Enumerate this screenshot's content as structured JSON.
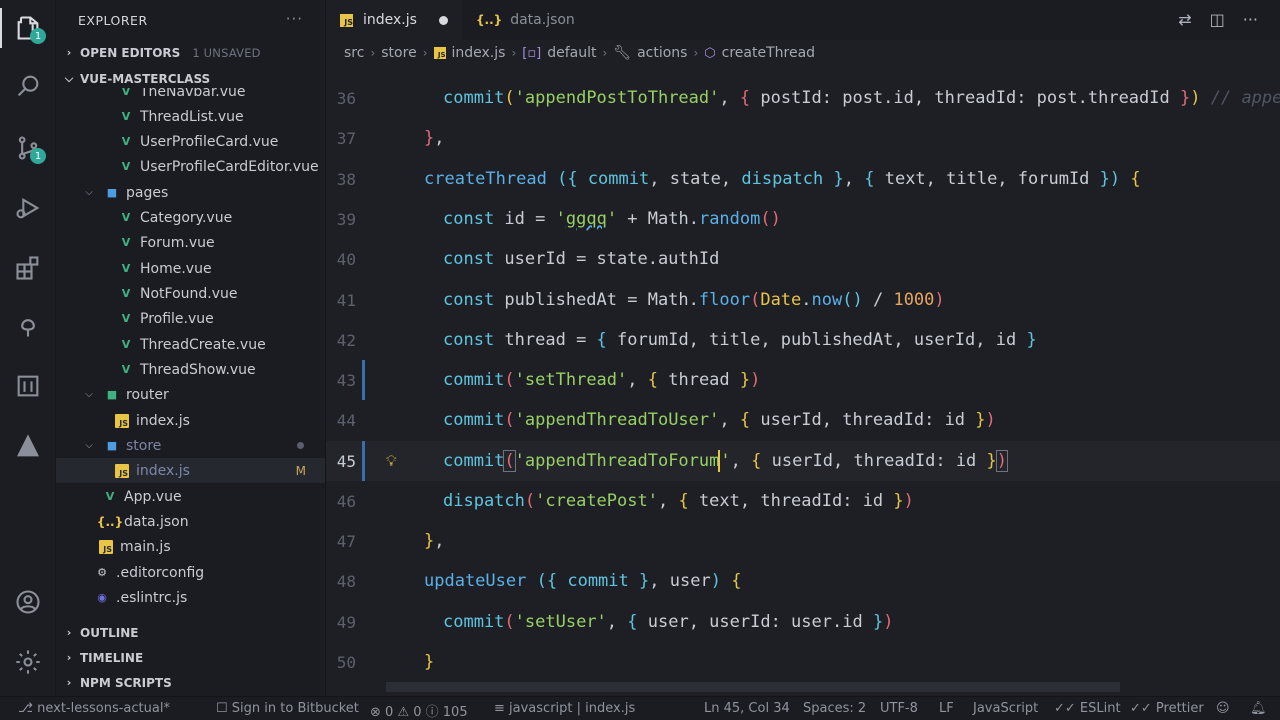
{
  "sidebar": {
    "title": "EXPLORER",
    "open_editors": {
      "label": "OPEN EDITORS",
      "extra": "1 UNSAVED"
    },
    "project": {
      "label": "VUE-MASTERCLASS"
    },
    "tree": [
      {
        "label": "TheNavbar.vue"
      },
      {
        "label": "ThreadList.vue"
      },
      {
        "label": "UserProfileCard.vue"
      },
      {
        "label": "UserProfileCardEditor.vue"
      },
      {
        "label": "pages"
      },
      {
        "label": "Category.vue"
      },
      {
        "label": "Forum.vue"
      },
      {
        "label": "Home.vue"
      },
      {
        "label": "NotFound.vue"
      },
      {
        "label": "Profile.vue"
      },
      {
        "label": "ThreadCreate.vue"
      },
      {
        "label": "ThreadShow.vue"
      },
      {
        "label": "router"
      },
      {
        "label": "index.js"
      },
      {
        "label": "store"
      },
      {
        "label": "index.js",
        "status": "M"
      },
      {
        "label": "App.vue"
      },
      {
        "label": "data.json"
      },
      {
        "label": "main.js"
      },
      {
        "label": ".editorconfig"
      },
      {
        "label": ".eslintrc.js"
      }
    ],
    "outline": "OUTLINE",
    "timeline": "TIMELINE",
    "npm_scripts": "NPM SCRIPTS"
  },
  "activity": {
    "explorer_badge": "1",
    "scm_badge": "1"
  },
  "tabs": [
    {
      "label": "index.js"
    },
    {
      "label": "data.json"
    }
  ],
  "breadcrumb": {
    "src": "src",
    "store": "store",
    "file": "index.js",
    "default": "default",
    "actions": "actions",
    "fn": "createThread"
  },
  "editor": {
    "line_numbers": [
      "36",
      "37",
      "38",
      "39",
      "40",
      "41",
      "42",
      "43",
      "44",
      "45",
      "46",
      "47",
      "48",
      "49",
      "50"
    ]
  },
  "status": {
    "branch": "next-lessons-actual*",
    "bitbucket": "Sign in to Bitbucket",
    "errors": "0",
    "warnings": "0",
    "infos": "105",
    "lang_context": "javascript",
    "file": "index.js",
    "position": "Ln 45, Col 34",
    "spaces": "Spaces: 2",
    "encoding": "UTF-8",
    "eol": "LF",
    "language": "JavaScript",
    "eslint": "ESLint",
    "prettier": "Prettier"
  }
}
